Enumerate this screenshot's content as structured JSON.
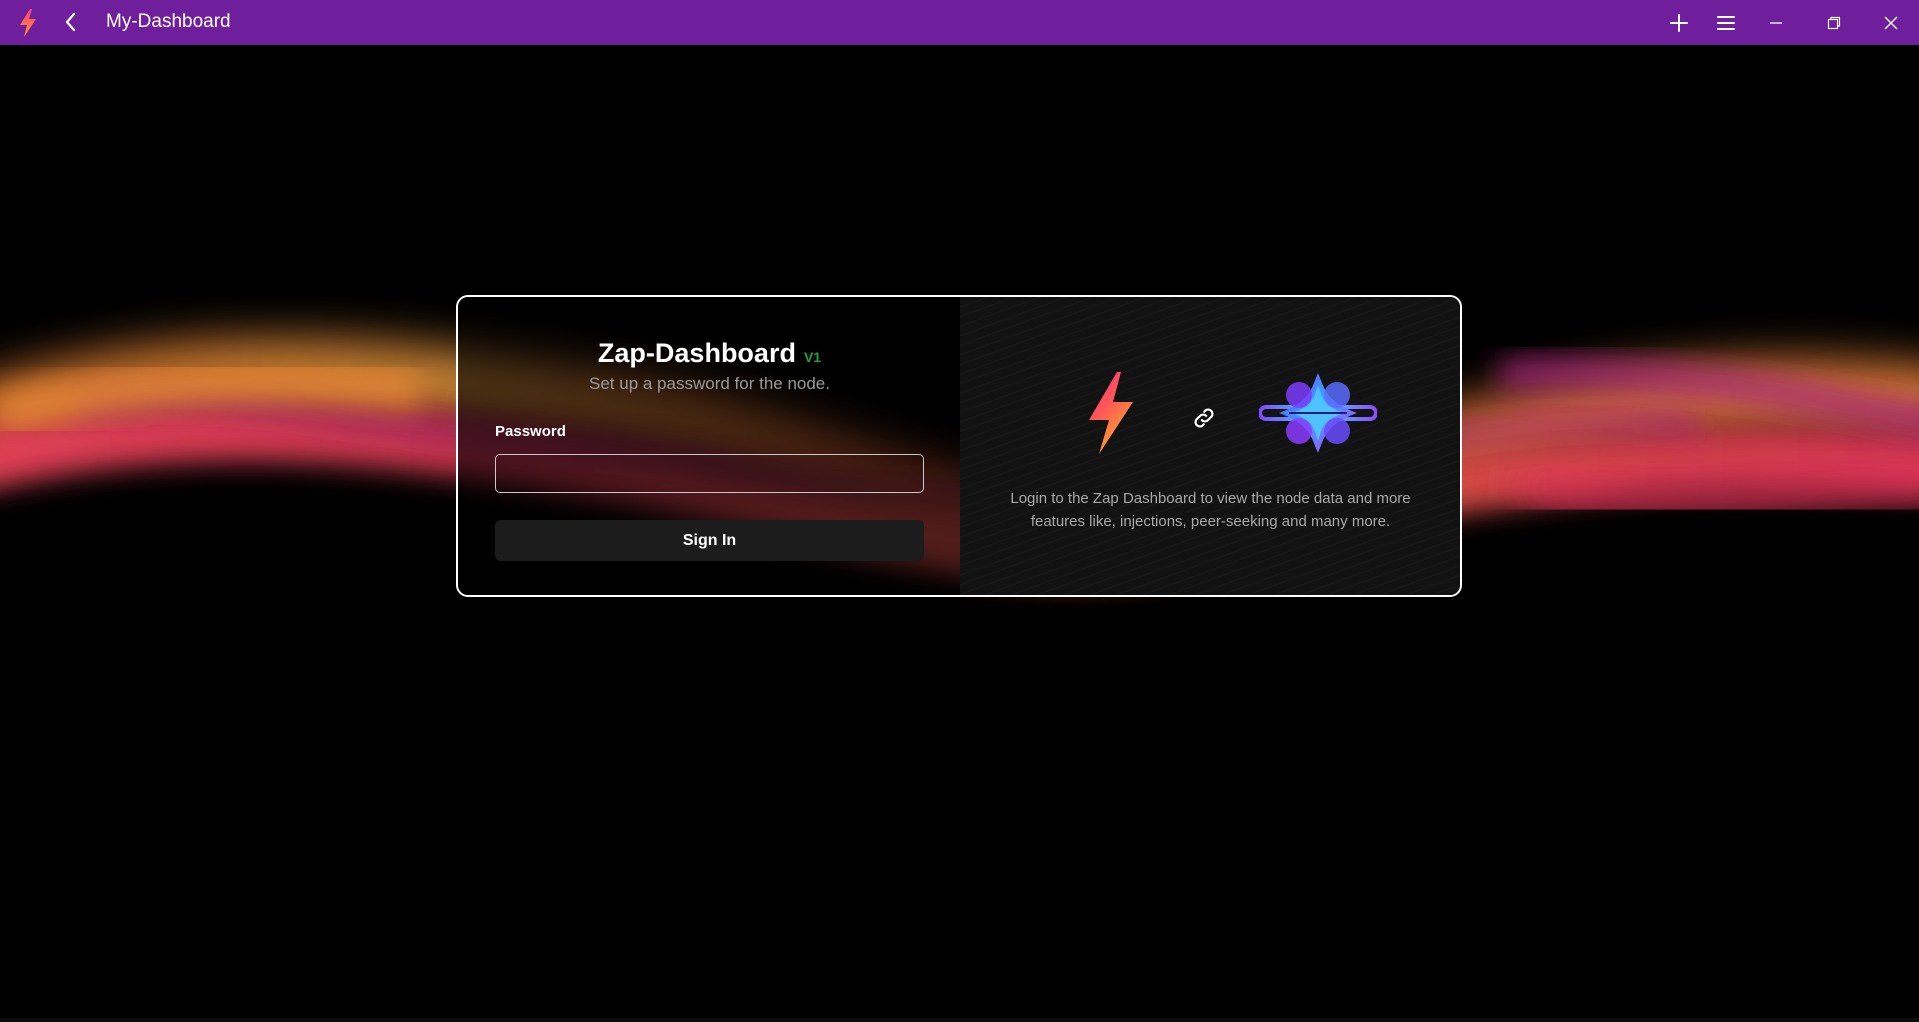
{
  "window": {
    "title": "My-Dashboard",
    "titlebar_color": "#6f1e9c",
    "icons": {
      "app": "zap-bolt-icon",
      "back": "chevron-left-icon",
      "add": "plus-icon",
      "menu": "hamburger-menu-icon",
      "minimize": "minimize-icon",
      "restore": "restore-icon",
      "close": "close-icon"
    }
  },
  "login": {
    "title": "Zap-Dashboard",
    "version": "V1",
    "version_color": "#22a33a",
    "subtitle": "Set up a password for the node.",
    "password_label": "Password",
    "password_value": "",
    "signin_label": "Sign In"
  },
  "info": {
    "icons": {
      "left_logo": "zap-bolt-logo",
      "connector": "link-icon",
      "right_logo": "node-star-logo"
    },
    "description": "Login to the Zap Dashboard to view the node data and more features like, injections, peer-seeking and many more."
  },
  "colors": {
    "background": "#000000",
    "card_border": "#ffffff",
    "wave_orange": "#e8762c",
    "wave_pink": "#e0305a",
    "wave_magenta": "#a0207a"
  }
}
